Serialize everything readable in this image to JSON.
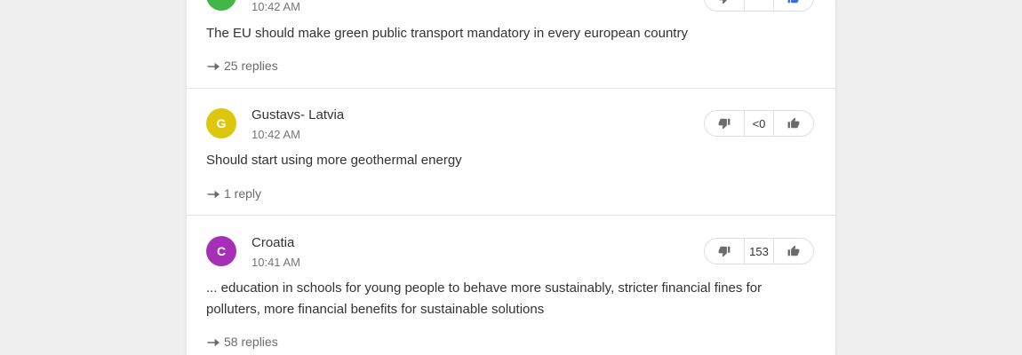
{
  "colors": {
    "avatar_green": "#43b649",
    "avatar_yellow": "#dcc60e",
    "avatar_purple": "#a530b5",
    "thumb_icon": "#6b6b6b",
    "thumb_active": "#3b6fd6"
  },
  "comments": [
    {
      "avatar_initial": "",
      "author": "",
      "time": "10:42 AM",
      "text": "The EU should make green public transport mandatory in every european country",
      "replies": "25 replies",
      "score": "",
      "thumbs_down_icon": "thumbs-down-icon",
      "thumbs_up_icon": "thumbs-up-icon"
    },
    {
      "avatar_initial": "G",
      "author": "Gustavs- Latvia",
      "time": "10:42 AM",
      "text": "Should start using more geothermal energy",
      "replies": "1 reply",
      "score": "<0",
      "thumbs_down_icon": "thumbs-down-icon",
      "thumbs_up_icon": "thumbs-up-icon"
    },
    {
      "avatar_initial": "C",
      "author": "Croatia",
      "time": "10:41 AM",
      "text": "... education in schools for young people to behave more sustainably, stricter financial fines for polluters, more financial benefits for sustainable solutions",
      "replies": "58 replies",
      "score": "153",
      "thumbs_down_icon": "thumbs-down-icon",
      "thumbs_up_icon": "thumbs-up-icon"
    }
  ]
}
